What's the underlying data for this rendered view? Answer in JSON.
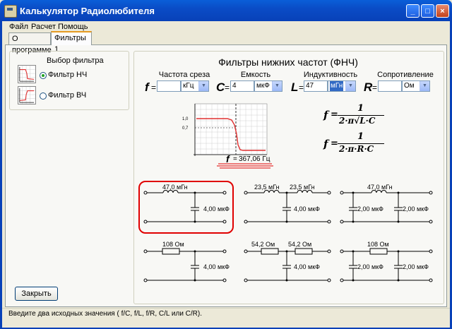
{
  "window": {
    "title": "Калькулятор Радиолюбителя",
    "min": "_",
    "max": "□",
    "close": "×"
  },
  "menu": [
    "Файл",
    "Расчет",
    "Помощь"
  ],
  "tabs": [
    {
      "label": "О программе"
    },
    {
      "label": "Фильтры 1"
    }
  ],
  "filter_select": {
    "title": "Выбор фильтра",
    "options": [
      {
        "label": "Фильтр НЧ",
        "checked": true
      },
      {
        "label": "Фильтр ВЧ",
        "checked": false
      }
    ]
  },
  "main": {
    "title": "Фильтры нижних частот (ФНЧ)",
    "params": [
      {
        "label": "Частота среза",
        "var": "f",
        "value": "",
        "unit": "кГц"
      },
      {
        "label": "Емкость",
        "var": "C",
        "value": "4",
        "unit": "мкФ"
      },
      {
        "label": "Индуктивность",
        "var": "L",
        "value": "47",
        "unit": "мГн"
      },
      {
        "label": "Сопротивление",
        "var": "R",
        "value": "",
        "unit": "Ом"
      }
    ],
    "equals": "=",
    "chart": {
      "y_labels": [
        "1,0",
        "0,7"
      ]
    },
    "result": {
      "var": "f",
      "text": "367,06 Гц"
    },
    "formulas": {
      "f": "f",
      "eq": "=",
      "num": "1",
      "den1": "2·π√L·C",
      "den2": "2·π·R·C"
    }
  },
  "circuits": {
    "lc1": {
      "l": "47,0 мГн",
      "c": "4,00 мкФ"
    },
    "lc2": {
      "l1": "23,5 мГн",
      "l2": "23,5 мГн",
      "c": "4,00 мкФ"
    },
    "lc3": {
      "l": "47,0 мГн",
      "c1": "2,00 мкФ",
      "c2": "2,00 мкФ"
    },
    "rc1": {
      "r": "108 Ом",
      "c": "4,00 мкФ"
    },
    "rc2": {
      "r1": "54,2 Ом",
      "r2": "54,2 Ом",
      "c": "4,00 мкФ"
    },
    "rc3": {
      "r": "108 Ом",
      "c1": "2,00 мкФ",
      "c2": "2,00 мкФ"
    }
  },
  "close_button": "Закрыть",
  "status": "Введите два исходных значения ( f/C, f/L, f/R, C/L или C/R).",
  "colors": {
    "title_bar": "#0A4CC6",
    "highlight": "#E00000",
    "curve": "#E03030",
    "selection": "#316AC5"
  }
}
